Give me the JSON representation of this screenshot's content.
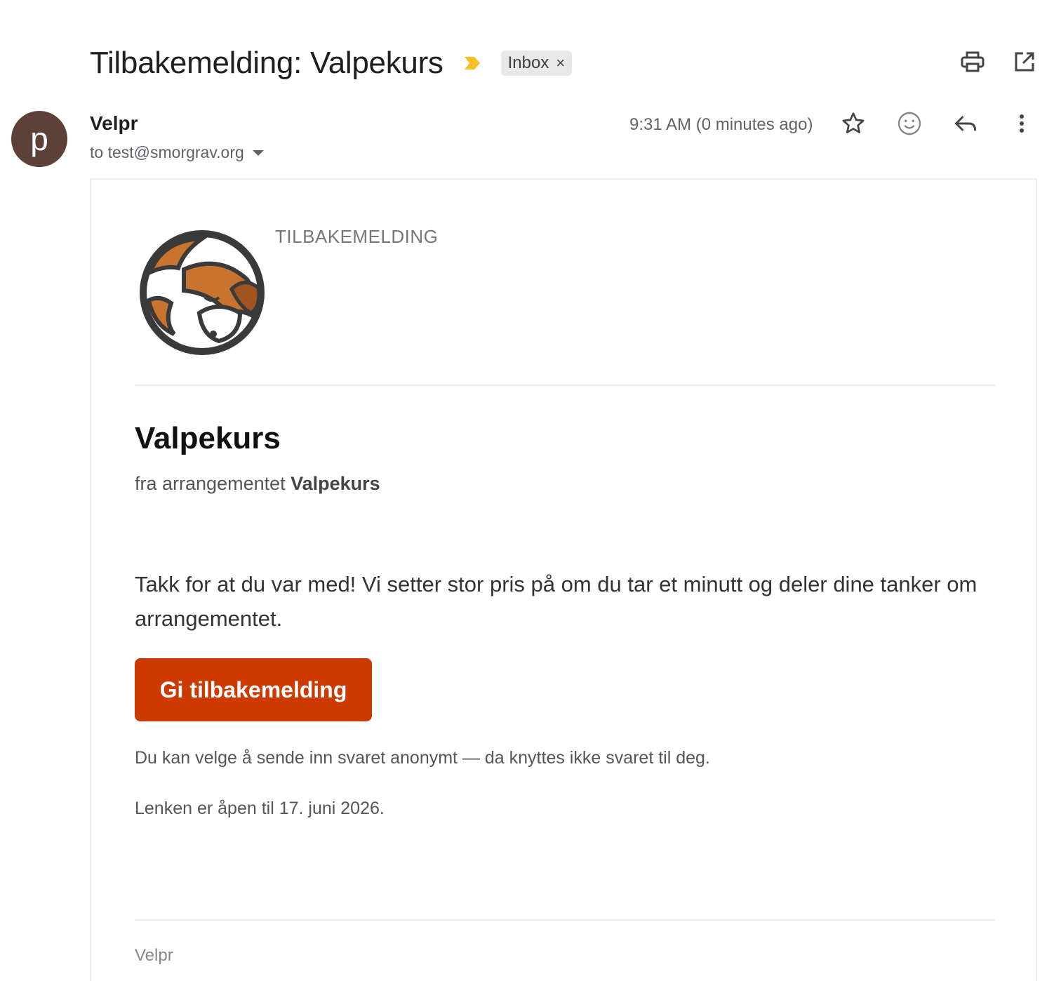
{
  "header": {
    "subject": "Tilbakemelding: Valpekurs",
    "importance_icon": "importance-marker-icon",
    "label": "Inbox",
    "label_remove": "×",
    "actions": [
      "print-icon",
      "open-in-new-window-icon"
    ]
  },
  "sender": {
    "avatar_letter": "p",
    "avatar_color": "#5d4037",
    "name": "Velpr",
    "recipient": "to test@smorgrav.org",
    "timestamp": "9:31 AM (0 minutes ago)",
    "actions": [
      "star-icon",
      "emoji-reaction-icon",
      "reply-icon",
      "more-options-icon"
    ]
  },
  "email": {
    "eyebrow": "TILBAKEMELDING",
    "title": "Valpekurs",
    "from_prefix": "fra arrangementet ",
    "event_name": "Valpekurs",
    "intro": "Takk for at du var med! Vi setter stor pris på om du tar et minutt og deler dine tanker om arrangementet.",
    "cta_label": "Gi tilbakemelding",
    "cta_color": "#cc3a00",
    "anonymous_note": "Du kan velge å sende inn svaret anonymt — da knyttes ikke svaret til deg.",
    "deadline_note": "Lenken er åpen til 17. juni 2026.",
    "footer": "Velpr"
  }
}
